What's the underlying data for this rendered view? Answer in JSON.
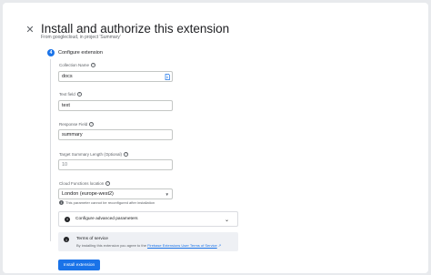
{
  "header": {
    "close_icon": "close-icon",
    "title": "Install and authorize this extension",
    "subtitle": "From googlecloud, in project 'Summary'"
  },
  "step": {
    "number": "4",
    "title": "Configure extension"
  },
  "fields": {
    "collection": {
      "label": "Collection Name",
      "value": "docs",
      "icon": "browse-collection-icon"
    },
    "text": {
      "label": "Text field",
      "value": "text"
    },
    "response": {
      "label": "Response Field",
      "value": "summary"
    },
    "target": {
      "label": "Target Summary Length (Optional)",
      "placeholder": "10"
    },
    "location": {
      "label": "Cloud Functions location",
      "value": "London (europe-west2)",
      "hint": "This parameter cannot be reconfigured after installation"
    }
  },
  "advanced": {
    "label": "Configure advanced parameters"
  },
  "tos": {
    "title": "Terms of service",
    "text_prefix": "By installing this extension you agree to the",
    "link": "Firebase Extensions User Terms of Service"
  },
  "actions": {
    "install_label": "Install extension"
  },
  "colors": {
    "accent": "#1a73e8",
    "background": "#e8eaed",
    "tos_background": "#eef0f4"
  }
}
